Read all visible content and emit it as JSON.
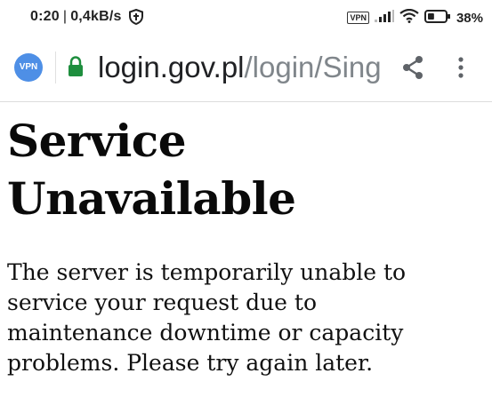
{
  "status_bar": {
    "time": "0:20",
    "separator": "|",
    "net_speed": "0,4kB/s",
    "vpn_label": "VPN",
    "battery_percent": "38%",
    "battery_level": 0.38
  },
  "url_bar": {
    "vpn_badge": "VPN",
    "domain": "login.gov.pl",
    "path": "/login/Sing"
  },
  "page": {
    "title": "Service Unavailable",
    "message": "The server is temporarily unable to service your request due to maintenance downtime or capacity problems. Please try again later."
  },
  "icons": {
    "shield": "shield-icon",
    "signal": "signal-icon",
    "wifi": "wifi-icon",
    "battery": "battery-icon",
    "lock": "lock-icon",
    "share": "share-icon",
    "menu": "more-vert-icon"
  },
  "colors": {
    "vpn_badge": "#4e8fe6",
    "lock": "#1e8e3e",
    "url_domain": "#202124",
    "url_path": "#80868b"
  }
}
